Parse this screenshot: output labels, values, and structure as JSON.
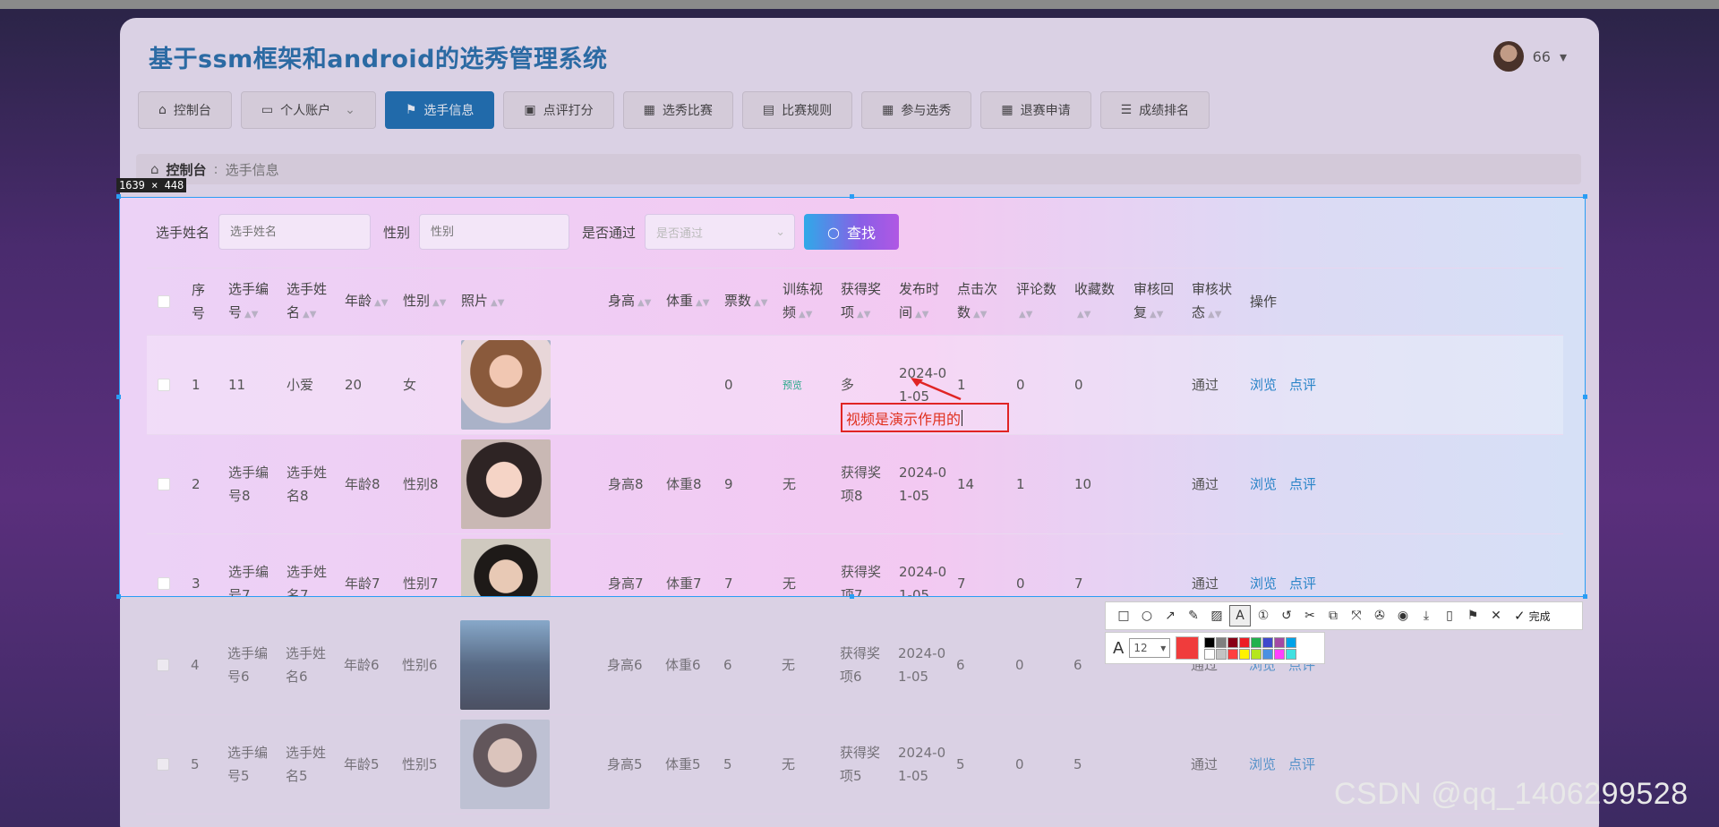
{
  "app": {
    "title": "基于ssm框架和android的选秀管理系统",
    "user_name": "66",
    "user_caret": "▾"
  },
  "nav": [
    {
      "label": "控制台",
      "icon": "⌂"
    },
    {
      "label": "个人账户",
      "icon": "▭",
      "caret": "⌄"
    },
    {
      "label": "选手信息",
      "icon": "⚑"
    },
    {
      "label": "点评打分",
      "icon": "▣"
    },
    {
      "label": "选秀比赛",
      "icon": "▦"
    },
    {
      "label": "比赛规则",
      "icon": "▤"
    },
    {
      "label": "参与选秀",
      "icon": "▦"
    },
    {
      "label": "退赛申请",
      "icon": "▦"
    },
    {
      "label": "成绩排名",
      "icon": "☰"
    }
  ],
  "breadcrumb": {
    "home": "控制台",
    "sep": ":",
    "current": "选手信息"
  },
  "capture": {
    "size_label": "1639 × 448"
  },
  "search": {
    "name_label": "选手姓名",
    "name_placeholder": "选手姓名",
    "gender_label": "性别",
    "gender_placeholder": "性别",
    "pass_label": "是否通过",
    "pass_placeholder": "是否通过",
    "find_label": "查找",
    "find_icon": "○"
  },
  "table": {
    "headers": [
      "序号",
      "选手编号",
      "选手姓名",
      "年龄",
      "性别",
      "照片",
      "身高",
      "体重",
      "票数",
      "训练视频",
      "获得奖项",
      "发布时间",
      "点击次数",
      "评论数",
      "收藏数",
      "审核回复",
      "审核状态",
      "操作"
    ],
    "header_lines": [
      [
        "序",
        "号"
      ],
      [
        "选手编",
        "号"
      ],
      [
        "选手姓",
        "名"
      ],
      [
        "年龄"
      ],
      [
        "性别"
      ],
      [
        "照片"
      ],
      [
        "身高"
      ],
      [
        "体重"
      ],
      [
        "票数"
      ],
      [
        "训练视",
        "频"
      ],
      [
        "获得奖",
        "项"
      ],
      [
        "发布时",
        "间"
      ],
      [
        "点击次",
        "数"
      ],
      [
        "评论数"
      ],
      [
        "收藏数"
      ],
      [
        "审核回",
        "复"
      ],
      [
        "审核状",
        "态"
      ],
      [
        "操作"
      ]
    ],
    "sortable": [
      false,
      true,
      true,
      true,
      true,
      true,
      true,
      true,
      true,
      true,
      true,
      true,
      true,
      true,
      true,
      true,
      true,
      false
    ],
    "rows": [
      {
        "idx": "1",
        "code": [
          "11"
        ],
        "name": [
          "小爱"
        ],
        "age": "20",
        "gender": "女",
        "height": "",
        "weight": "",
        "votes": "0",
        "video": "预览",
        "award": [
          "多"
        ],
        "date": [
          "2024-0",
          "1-05"
        ],
        "clicks": "1",
        "comments": "0",
        "favs": "0",
        "reply": "",
        "status": "通过"
      },
      {
        "idx": "2",
        "code": [
          "选手编",
          "号8"
        ],
        "name": [
          "选手姓",
          "名8"
        ],
        "age": "年龄8",
        "gender": "性别8",
        "height": "身高8",
        "weight": "体重8",
        "votes": "9",
        "video": "无",
        "award": [
          "获得奖",
          "项8"
        ],
        "date": [
          "2024-0",
          "1-05"
        ],
        "clicks": "14",
        "comments": "1",
        "favs": "10",
        "reply": "",
        "status": "通过"
      },
      {
        "idx": "3",
        "code": [
          "选手编",
          "号7"
        ],
        "name": [
          "选手姓",
          "名7"
        ],
        "age": "年龄7",
        "gender": "性别7",
        "height": "身高7",
        "weight": "体重7",
        "votes": "7",
        "video": "无",
        "award": [
          "获得奖",
          "项7"
        ],
        "date": [
          "2024-0",
          "1-05"
        ],
        "clicks": "7",
        "comments": "0",
        "favs": "7",
        "reply": "",
        "status": "通过"
      },
      {
        "idx": "4",
        "code": [
          "选手编",
          "号6"
        ],
        "name": [
          "选手姓",
          "名6"
        ],
        "age": "年龄6",
        "gender": "性别6",
        "height": "身高6",
        "weight": "体重6",
        "votes": "6",
        "video": "无",
        "award": [
          "获得奖",
          "项6"
        ],
        "date": [
          "2024-0",
          "1-05"
        ],
        "clicks": "6",
        "comments": "0",
        "favs": "6",
        "reply": "",
        "status": "通过"
      },
      {
        "idx": "5",
        "code": [
          "选手编",
          "号5"
        ],
        "name": [
          "选手姓",
          "名5"
        ],
        "age": "年龄5",
        "gender": "性别5",
        "height": "身高5",
        "weight": "体重5",
        "votes": "5",
        "video": "无",
        "award": [
          "获得奖",
          "项5"
        ],
        "date": [
          "2024-0",
          "1-05"
        ],
        "clicks": "5",
        "comments": "0",
        "favs": "5",
        "reply": "",
        "status": "通过"
      }
    ],
    "actions": {
      "view": "浏览",
      "comment": "点评"
    }
  },
  "annotation": {
    "text": "视频是演示作用的"
  },
  "toolbar": {
    "tools": [
      "□",
      "○",
      "↗",
      "✎",
      "▨",
      "A",
      "①",
      "↺",
      "✂",
      "⧉",
      "⤧",
      "✇",
      "◉",
      "⤓",
      "▯",
      "⚑",
      "✕"
    ],
    "done_icon": "✓",
    "done_label": "完成",
    "font_icon": "A",
    "font_size": "12",
    "font_caret": "▾",
    "current_color": "#f03c3c",
    "palette": [
      "#000000",
      "#7f7f7f",
      "#880015",
      "#ed1c24",
      "#22b14c",
      "#3f48cc",
      "#a349a4",
      "#00a2e8",
      "#ffffff",
      "#c3c3c3",
      "#ff4040",
      "#fff200",
      "#b5e61d",
      "#4a90e2",
      "#ff40ff",
      "#40e0e0"
    ]
  },
  "watermark": "CSDN @qq_1406299528"
}
